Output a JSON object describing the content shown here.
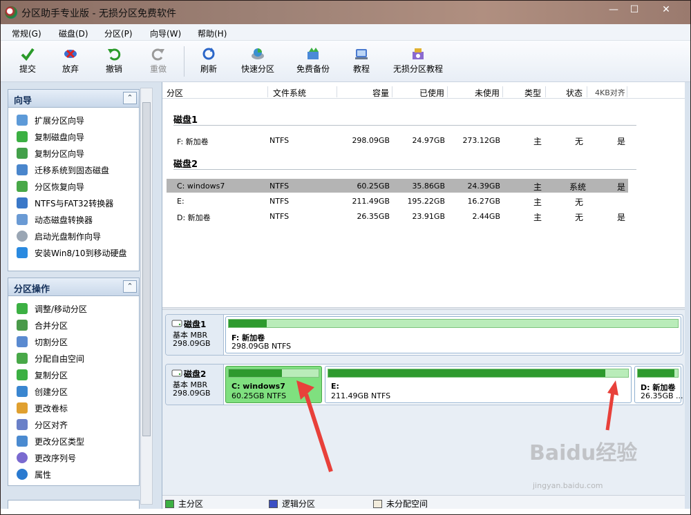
{
  "app": {
    "title": "分区助手专业版 - 无损分区免费软件"
  },
  "window_controls": {
    "minimize": "—",
    "maximize": "☐",
    "close": "✕"
  },
  "menu": [
    "常规(G)",
    "磁盘(D)",
    "分区(P)",
    "向导(W)",
    "帮助(H)"
  ],
  "toolbar": [
    {
      "label": "提交",
      "icon": "check-icon",
      "enabled": true
    },
    {
      "label": "放弃",
      "icon": "discard-icon",
      "enabled": true
    },
    {
      "label": "撤销",
      "icon": "undo-icon",
      "enabled": true
    },
    {
      "label": "重做",
      "icon": "redo-icon",
      "enabled": false
    },
    {
      "label": "刷新",
      "icon": "refresh-icon",
      "enabled": true
    },
    {
      "label": "快速分区",
      "icon": "quick-partition-icon",
      "enabled": true
    },
    {
      "label": "免费备份",
      "icon": "backup-icon",
      "enabled": true
    },
    {
      "label": "教程",
      "icon": "tutorial-icon",
      "enabled": true
    },
    {
      "label": "无损分区教程",
      "icon": "lossless-tutorial-icon",
      "enabled": true
    }
  ],
  "wizard_panel": {
    "title": "向导",
    "items": [
      {
        "label": "扩展分区向导",
        "icon": "extend-icon"
      },
      {
        "label": "复制磁盘向导",
        "icon": "copy-disk-icon"
      },
      {
        "label": "复制分区向导",
        "icon": "copy-partition-icon"
      },
      {
        "label": "迁移系统到固态磁盘",
        "icon": "migrate-icon"
      },
      {
        "label": "分区恢复向导",
        "icon": "recovery-icon"
      },
      {
        "label": "NTFS与FAT32转换器",
        "icon": "convert-icon"
      },
      {
        "label": "动态磁盘转换器",
        "icon": "dynamic-disk-icon"
      },
      {
        "label": "启动光盘制作向导",
        "icon": "boot-disc-icon"
      },
      {
        "label": "安装Win8/10到移动硬盘",
        "icon": "windows-icon"
      }
    ]
  },
  "ops_panel": {
    "title": "分区操作",
    "items": [
      {
        "label": "调整/移动分区",
        "icon": "resize-icon"
      },
      {
        "label": "合并分区",
        "icon": "merge-icon"
      },
      {
        "label": "切割分区",
        "icon": "split-icon"
      },
      {
        "label": "分配自由空间",
        "icon": "allocate-icon"
      },
      {
        "label": "复制分区",
        "icon": "copy-icon"
      },
      {
        "label": "创建分区",
        "icon": "create-icon"
      },
      {
        "label": "更改卷标",
        "icon": "label-icon"
      },
      {
        "label": "分区对齐",
        "icon": "align-icon"
      },
      {
        "label": "更改分区类型",
        "icon": "type-icon"
      },
      {
        "label": "更改序列号",
        "icon": "serial-icon"
      },
      {
        "label": "属性",
        "icon": "info-icon"
      }
    ]
  },
  "table": {
    "headers": [
      "分区",
      "文件系统",
      "容量",
      "已使用",
      "未使用",
      "类型",
      "状态",
      "4KB对齐"
    ],
    "disks": [
      {
        "name": "磁盘1",
        "rows": [
          {
            "partition": "F: 新加卷",
            "fs": "NTFS",
            "capacity": "298.09GB",
            "used": "24.97GB",
            "free": "273.12GB",
            "type": "主",
            "status": "无",
            "align": "是",
            "selected": false
          }
        ]
      },
      {
        "name": "磁盘2",
        "rows": [
          {
            "partition": "C: windows7",
            "fs": "NTFS",
            "capacity": "60.25GB",
            "used": "35.86GB",
            "free": "24.39GB",
            "type": "主",
            "status": "系统",
            "align": "是",
            "selected": true
          },
          {
            "partition": "E:",
            "fs": "NTFS",
            "capacity": "211.49GB",
            "used": "195.22GB",
            "free": "16.27GB",
            "type": "主",
            "status": "无",
            "align": "",
            "selected": false
          },
          {
            "partition": "D: 新加卷",
            "fs": "NTFS",
            "capacity": "26.35GB",
            "used": "23.91GB",
            "free": "2.44GB",
            "type": "主",
            "status": "无",
            "align": "是",
            "selected": false
          }
        ]
      }
    ]
  },
  "disk_map": [
    {
      "name": "磁盘1",
      "type": "基本 MBR",
      "size": "298.09GB",
      "partitions": [
        {
          "name": "F: 新加卷",
          "info": "298.09GB NTFS",
          "used_fraction": 0.084,
          "selected": false
        }
      ]
    },
    {
      "name": "磁盘2",
      "type": "基本 MBR",
      "size": "298.09GB",
      "partitions": [
        {
          "name": "C: windows7",
          "info": "60.25GB NTFS",
          "used_fraction": 0.595,
          "selected": true
        },
        {
          "name": "E:",
          "info": "211.49GB NTFS",
          "used_fraction": 0.923,
          "selected": false
        },
        {
          "name": "D: 新加卷",
          "info": "26.35GB ...",
          "used_fraction": 0.907,
          "selected": false
        }
      ]
    }
  ],
  "legend": [
    {
      "label": "主分区",
      "color": "#3cb043"
    },
    {
      "label": "逻辑分区",
      "color": "#3b4fc4"
    },
    {
      "label": "未分配空间",
      "color": "#f2ecdc"
    }
  ],
  "watermark": {
    "main": "Baidu经验",
    "sub": "jingyan.baidu.com"
  },
  "colors": {
    "selected_partition": "#7fe07f",
    "used_bar": "#2e9a2e",
    "annotation_arrow": "#e8403a"
  }
}
